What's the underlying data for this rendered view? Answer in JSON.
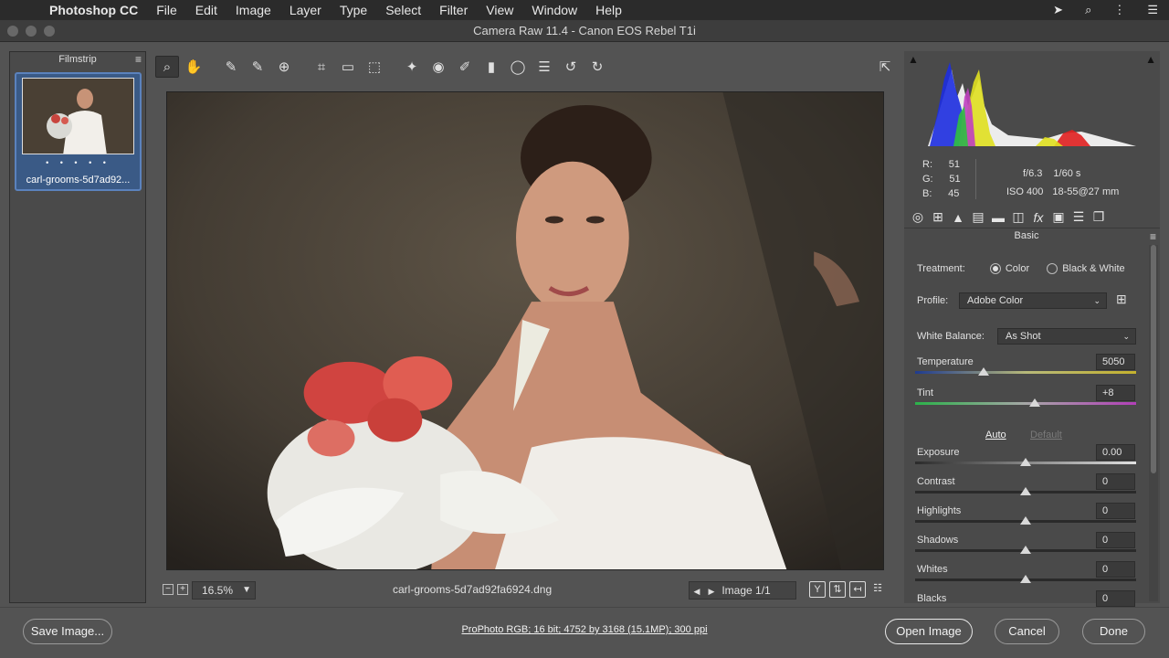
{
  "menubar": {
    "app_name": "Photoshop CC",
    "items": [
      "File",
      "Edit",
      "Image",
      "Layer",
      "Type",
      "Select",
      "Filter",
      "View",
      "Window",
      "Help"
    ]
  },
  "window": {
    "title": "Camera Raw 11.4  -  Canon EOS Rebel T1i"
  },
  "filmstrip": {
    "title": "Filmstrip",
    "rating_dots": "• • • • •",
    "thumbnail_name": "carl-grooms-5d7ad92..."
  },
  "toolbar": {
    "tools": [
      "zoom-tool",
      "hand-tool",
      "white-balance-tool",
      "color-sampler-tool",
      "targeted-adjustment-tool",
      "crop-tool",
      "straighten-tool",
      "transform-tool",
      "spot-removal-tool",
      "red-eye-tool",
      "adjustment-brush-tool",
      "graduated-filter-tool",
      "radial-filter-tool",
      "preferences",
      "rotate-ccw",
      "rotate-cw"
    ]
  },
  "status": {
    "zoom_value": "16.5%",
    "filename": "carl-grooms-5d7ad92fa6924.dng",
    "image_counter": "Image 1/1"
  },
  "readout": {
    "r_label": "R:",
    "r_value": "51",
    "g_label": "G:",
    "g_value": "51",
    "b_label": "B:",
    "b_value": "45",
    "aperture": "f/6.3",
    "shutter": "1/60 s",
    "iso": "ISO 400",
    "lens": "18-55@27 mm"
  },
  "basic": {
    "panel_title": "Basic",
    "treatment_label": "Treatment:",
    "treatment_color": "Color",
    "treatment_bw": "Black & White",
    "profile_label": "Profile:",
    "profile_value": "Adobe Color",
    "wb_label": "White Balance:",
    "wb_value": "As Shot",
    "auto_label": "Auto",
    "default_label": "Default",
    "sliders": [
      {
        "label": "Temperature",
        "value": "5050",
        "position": 0.31
      },
      {
        "label": "Tint",
        "value": "+8",
        "position": 0.54
      },
      {
        "label": "Exposure",
        "value": "0.00",
        "position": 0.5
      },
      {
        "label": "Contrast",
        "value": "0",
        "position": 0.5
      },
      {
        "label": "Highlights",
        "value": "0",
        "position": 0.5
      },
      {
        "label": "Shadows",
        "value": "0",
        "position": 0.5
      },
      {
        "label": "Whites",
        "value": "0",
        "position": 0.5
      },
      {
        "label": "Blacks",
        "value": "0",
        "position": 0.5
      }
    ]
  },
  "bottom": {
    "save_label": "Save Image...",
    "workflow_text": "ProPhoto RGB; 16 bit; 4752 by 3168 (15.1MP); 300 ppi",
    "open_label": "Open Image",
    "cancel_label": "Cancel",
    "done_label": "Done"
  }
}
